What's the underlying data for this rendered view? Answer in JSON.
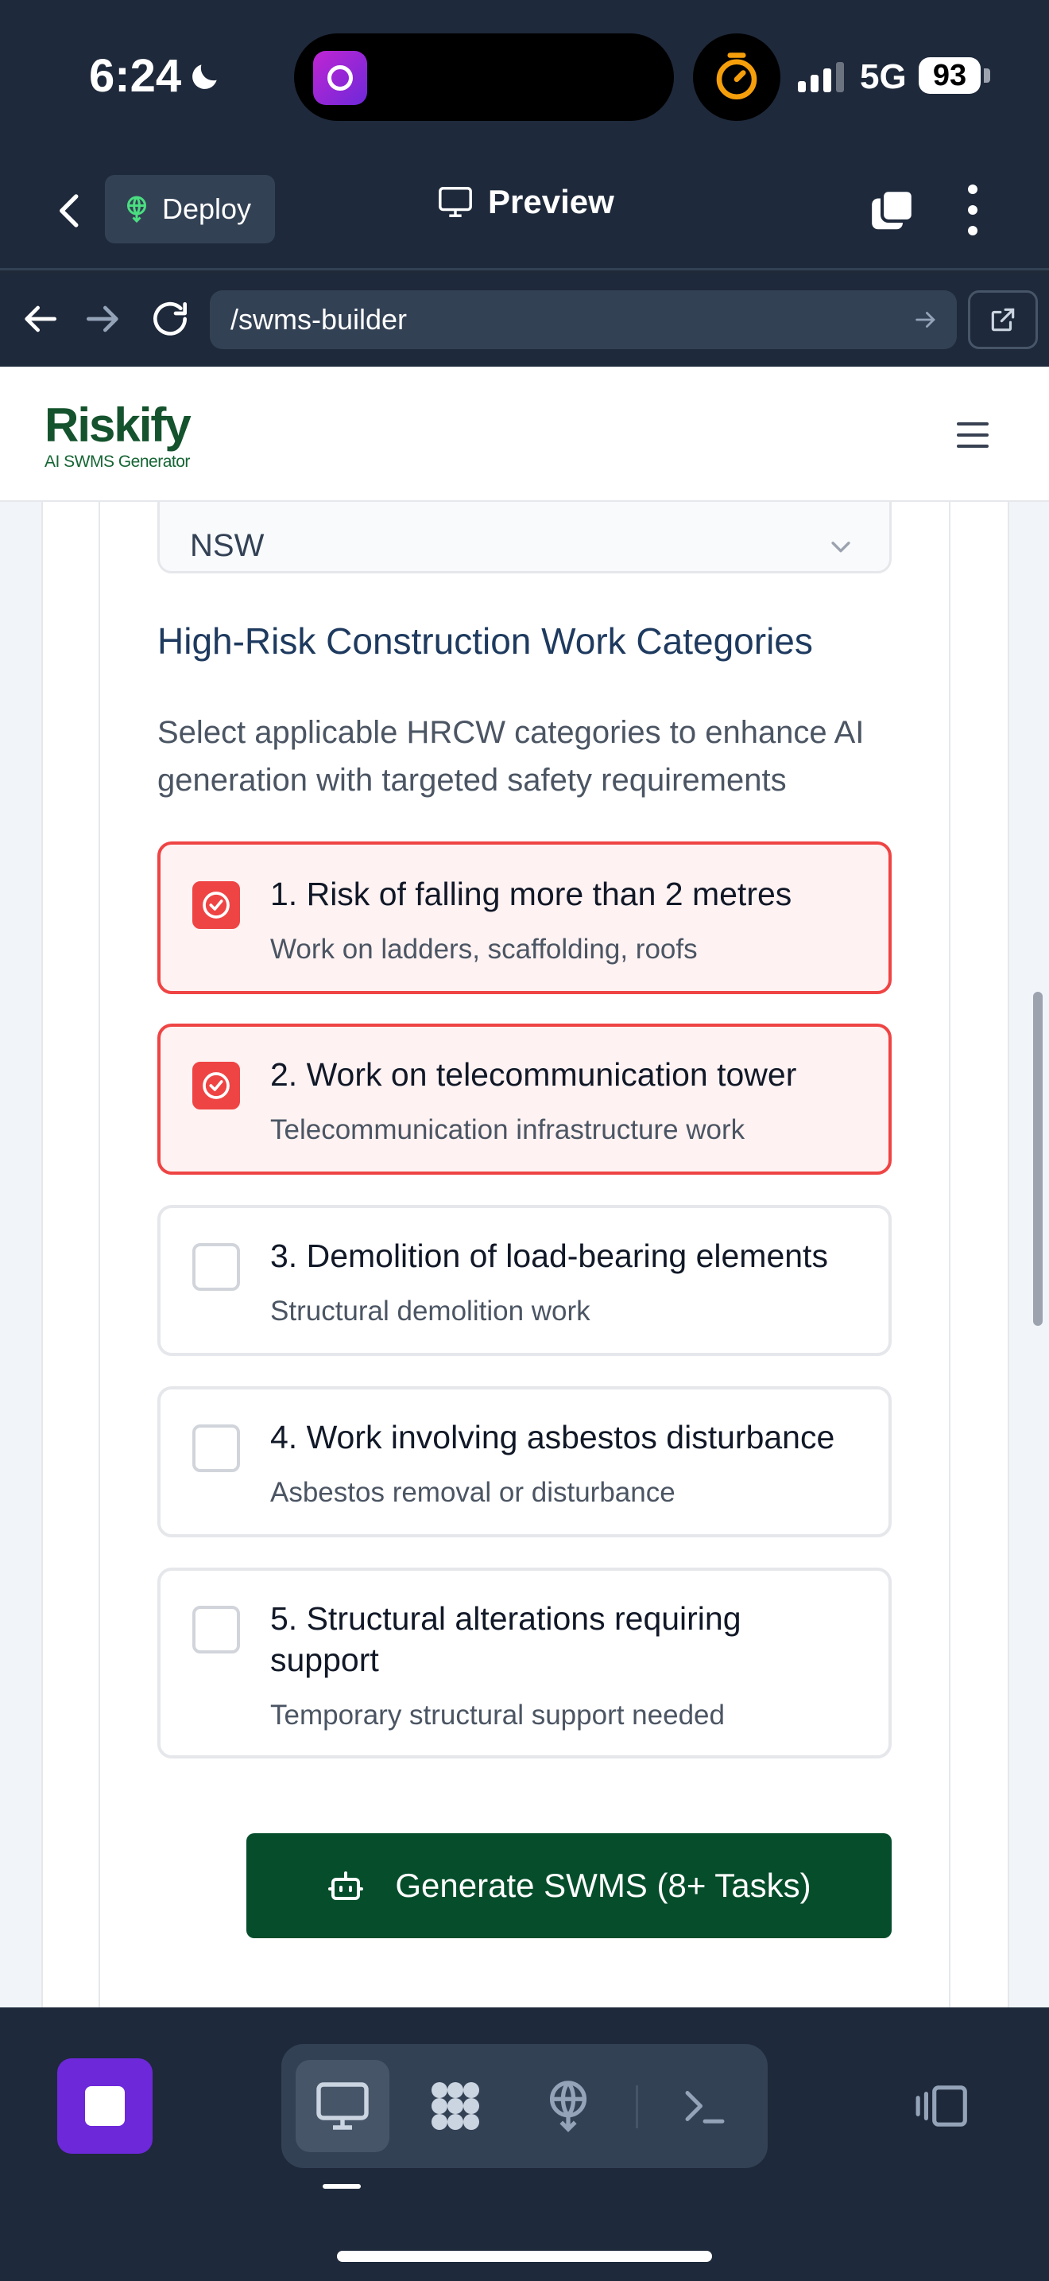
{
  "status_bar": {
    "time": "6:24",
    "network": "5G",
    "battery": "93",
    "icons": [
      "moon-icon",
      "timer-icon",
      "signal-icon"
    ]
  },
  "app_header": {
    "deploy_label": "Deploy",
    "preview_label": "Preview"
  },
  "url_bar": {
    "url": "/swms-builder"
  },
  "site": {
    "logo_text": "Riskify",
    "logo_subtitle": "AI SWMS Generator",
    "state_value": "NSW",
    "section_title": "High-Risk Construction Work Categories",
    "section_description": "Select applicable HRCW categories to enhance AI generation with targeted safety requirements",
    "options": [
      {
        "title": "1. Risk of falling more than 2 metres",
        "subtitle": "Work on ladders, scaffolding, roofs",
        "checked": true
      },
      {
        "title": "2. Work on telecommunication tower",
        "subtitle": "Telecommunication infrastructure work",
        "checked": true
      },
      {
        "title": "3. Demolition of load-bearing elements",
        "subtitle": "Structural demolition work",
        "checked": false
      },
      {
        "title": "4. Work involving asbestos disturbance",
        "subtitle": "Asbestos removal or disturbance",
        "checked": false
      },
      {
        "title": "5. Structural alterations requiring support",
        "subtitle": "Temporary structural support needed",
        "checked": false
      }
    ],
    "generate_label": "Generate SWMS (8+ Tasks)"
  },
  "colors": {
    "accent_red": "#ef4444",
    "brand_green": "#064e2b",
    "chrome_dark": "#1e293b",
    "stop_purple": "#6d28d9"
  }
}
